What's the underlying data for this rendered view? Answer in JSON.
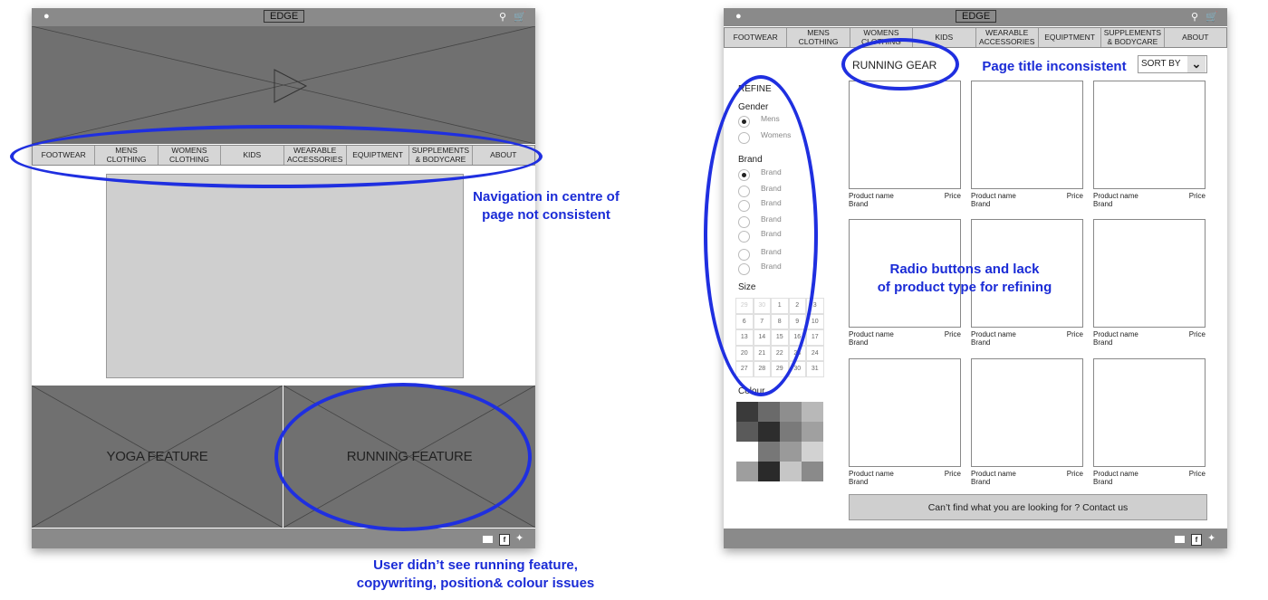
{
  "left_wireframe": {
    "logo": "EDGE",
    "nav": [
      "FOOTWEAR",
      "MENS\nCLOTHING",
      "WOMENS\nCLOTHING",
      "KIDS",
      "WEARABLE\nACCESSORIES",
      "EQUIPTMENT",
      "SUPPLEMENTS\n& BODYCARE",
      "ABOUT"
    ],
    "yoga_feature": "YOGA FEATURE",
    "running_feature": "RUNNING FEATURE",
    "icons": [
      "user-icon",
      "search-icon",
      "cart-icon",
      "play-icon",
      "mail-icon",
      "facebook-icon",
      "twitter-icon"
    ]
  },
  "right_wireframe": {
    "logo": "EDGE",
    "nav": [
      "FOOTWEAR",
      "MENS\nCLOTHING",
      "WOMENS\nCLOTHING",
      "KIDS",
      "WEARABLE\nACCESSORIES",
      "EQUIPTMENT",
      "SUPPLEMENTS\n& BODYCARE",
      "ABOUT"
    ],
    "page_title": "RUNNING GEAR",
    "sort_by": "SORT BY",
    "refine": {
      "title": "REFINE",
      "gender_title": "Gender",
      "genders": [
        "Mens",
        "Womens"
      ],
      "brand_title": "Brand",
      "brands": [
        "Brand",
        "Brand",
        "Brand",
        "Brand",
        "Brand",
        "Brand",
        "Brand"
      ],
      "size_title": "Size",
      "sizes": [
        "29",
        "30",
        "1",
        "2",
        "3",
        "6",
        "7",
        "8",
        "9",
        "10",
        "13",
        "14",
        "15",
        "16",
        "17",
        "20",
        "21",
        "22",
        "23",
        "24",
        "27",
        "28",
        "29",
        "30",
        "31"
      ],
      "colour_title": "Colour",
      "swatches": [
        "#3a3a3a",
        "#6a6a6a",
        "#8e8e8e",
        "#b8b8b8",
        "#5a5a5a",
        "#2d2d2d",
        "#7a7a7a",
        "#a0a0a0",
        "#ffffff",
        "#777777",
        "#9a9a9a",
        "#d2d2d2",
        "#9e9e9e",
        "#2a2a2a",
        "#c6c6c6",
        "#8a8a8a"
      ]
    },
    "products": [
      {
        "name": "Product name",
        "price": "Price",
        "brand": "Brand"
      },
      {
        "name": "Product name",
        "price": "Price",
        "brand": "Brand"
      },
      {
        "name": "Product name",
        "price": "Price",
        "brand": "Brand"
      },
      {
        "name": "Product name",
        "price": "Price",
        "brand": "Brand"
      },
      {
        "name": "Product name",
        "price": "Price",
        "brand": "Brand"
      },
      {
        "name": "Product name",
        "price": "Price",
        "brand": "Brand"
      },
      {
        "name": "Product name",
        "price": "Price",
        "brand": "Brand"
      },
      {
        "name": "Product name",
        "price": "Price",
        "brand": "Brand"
      },
      {
        "name": "Product name",
        "price": "Price",
        "brand": "Brand"
      }
    ],
    "contact": "Can’t find what you are looking for ? Contact us"
  },
  "annotations": {
    "navigation": "Navigation in centre of\npage not consistent",
    "page_title": "Page title inconsistent",
    "radio": "Radio buttons and lack\nof product type for refining",
    "running": "User didn’t see running feature,\ncopywriting, position& colour issues"
  },
  "colors": {
    "annotation": "#1a2bd6",
    "bar": "#8a8a8a",
    "placeholder": "#707070"
  }
}
